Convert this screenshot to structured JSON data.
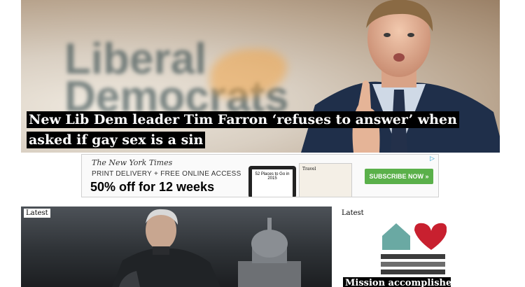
{
  "hero": {
    "headline": "New Lib Dem leader Tim Farron ‘refuses to answer’ when asked if gay sex is a sin",
    "background_logo_lines": [
      "Liberal",
      "Democrats"
    ]
  },
  "ad": {
    "brand": "The New York Times",
    "line1": "PRINT DELIVERY + FREE ONLINE ACCESS",
    "line2": "50% off for 12 weeks",
    "device_text": "52 Places to Go in 2015",
    "paper_text": "Travel",
    "cta": "SUBSCRIBE NOW »",
    "adchoices_icon": "adchoices-icon"
  },
  "tiles": {
    "left_badge": "Latest",
    "right_badge": "Latest",
    "right_caption": "Mission accomplished!"
  },
  "colors": {
    "headline_bg": "#000000",
    "subscribe_green": "#5ab04a",
    "emblem_teal": "#6aa9a3",
    "emblem_red": "#c8202f"
  }
}
